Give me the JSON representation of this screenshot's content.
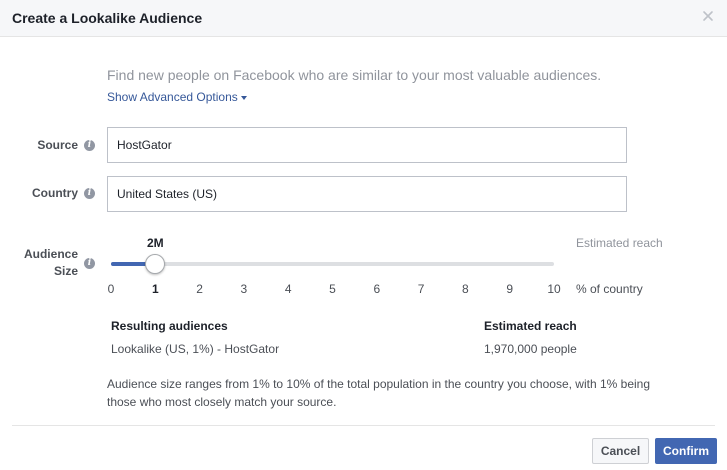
{
  "dialog": {
    "title": "Create a Lookalike Audience",
    "close_icon": "close-icon"
  },
  "intro": {
    "text": "Find new people on Facebook who are similar to your most valuable audiences.",
    "advanced_link": "Show Advanced Options"
  },
  "source": {
    "label": "Source",
    "value": "HostGator"
  },
  "country": {
    "label": "Country",
    "value": "United States (US)"
  },
  "audience_size": {
    "label_line1": "Audience",
    "label_line2": "Size",
    "reach_value": "2M",
    "estimated_reach_label": "Estimated reach",
    "selected_percent": 1,
    "max_percent": 10,
    "ticks": [
      "0",
      "1",
      "2",
      "3",
      "4",
      "5",
      "6",
      "7",
      "8",
      "9",
      "10"
    ],
    "unit_label": "% of country"
  },
  "results": {
    "audiences_header": "Resulting audiences",
    "reach_header": "Estimated reach",
    "audience_name": "Lookalike (US, 1%) - HostGator",
    "reach_value": "1,970,000 people"
  },
  "note": "Audience size ranges from 1% to 10% of the total population in the country you choose, with 1% being those who most closely match your source.",
  "footer": {
    "cancel_label": "Cancel",
    "confirm_label": "Confirm"
  },
  "colors": {
    "accent": "#4267b2",
    "link": "#365899"
  }
}
